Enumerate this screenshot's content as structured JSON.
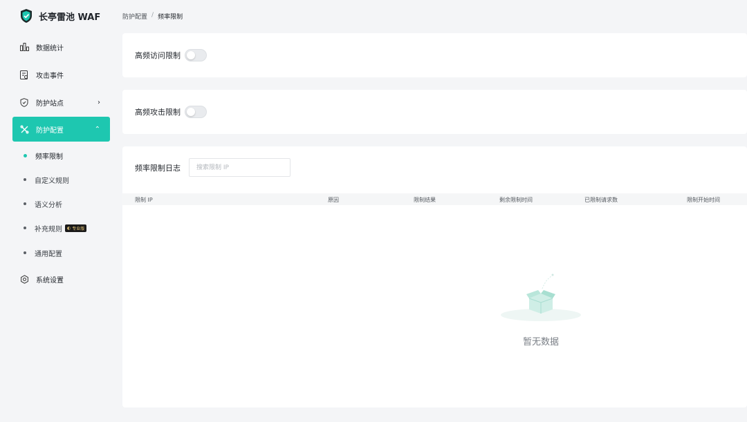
{
  "app": {
    "title": "长亭雷池 WAF"
  },
  "sidebar": {
    "items": [
      {
        "label": "数据统计",
        "icon": "bar-chart-icon"
      },
      {
        "label": "攻击事件",
        "icon": "document-icon"
      },
      {
        "label": "防护站点",
        "icon": "shield-icon",
        "arrow": "›"
      },
      {
        "label": "防护配置",
        "icon": "tools-icon",
        "arrow": "⌃"
      },
      {
        "label": "系统设置",
        "icon": "gear-icon"
      }
    ],
    "sub_items": [
      {
        "label": "频率限制"
      },
      {
        "label": "自定义规则"
      },
      {
        "label": "语义分析"
      },
      {
        "label": "补充规则",
        "badge": "专业版"
      },
      {
        "label": "通用配置"
      }
    ]
  },
  "breadcrumb": {
    "parent": "防护配置",
    "separator": "/",
    "current": "频率限制"
  },
  "cards": {
    "high_freq_access": "高频访问限制",
    "high_freq_attack": "高频攻击限制"
  },
  "log": {
    "title": "频率限制日志",
    "search_placeholder": "搜索限制 IP",
    "columns": [
      "限制 IP",
      "原因",
      "限制结果",
      "剩余限制时间",
      "已限制请求数",
      "限制开始时间"
    ],
    "empty_text": "暂无数据"
  },
  "colors": {
    "accent": "#1ec7b0",
    "background": "#f4f5f7"
  }
}
